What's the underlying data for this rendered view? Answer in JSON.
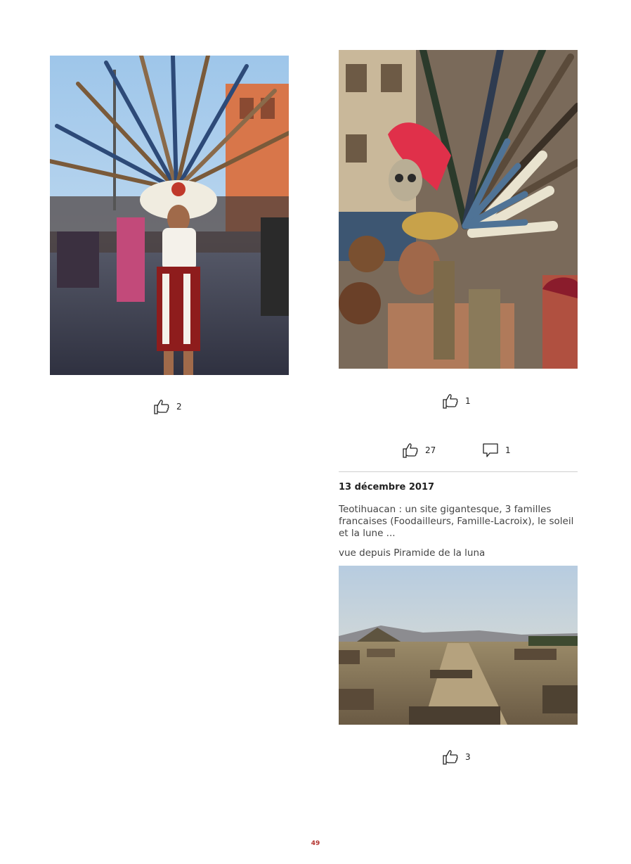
{
  "left_column": {
    "photo_alt": "Aztec dancer with feather headdress in plaza",
    "likes": "2"
  },
  "right_column": {
    "photo_alt": "Dancer with skull and feather headdress",
    "photo_likes": "1",
    "post_likes": "27",
    "post_comments": "1"
  },
  "post": {
    "date": "13 décembre 2017",
    "title": "Teotihuacan : un site gigantesque, 3 familles francaises (Foodailleurs, Famille-Lacroix), le soleil et la lune ...",
    "caption": "vue depuis Piramide de la luna",
    "photo_alt": "View of Teotihuacan avenue and Pyramid of the Sun",
    "likes": "3"
  },
  "footer": {
    "page_number": "49"
  },
  "icons": {
    "like": "thumbs-up-icon",
    "comment": "speech-bubble-icon"
  },
  "colors": {
    "page_number": "#b3342f",
    "divider": "#cfcfcf"
  }
}
